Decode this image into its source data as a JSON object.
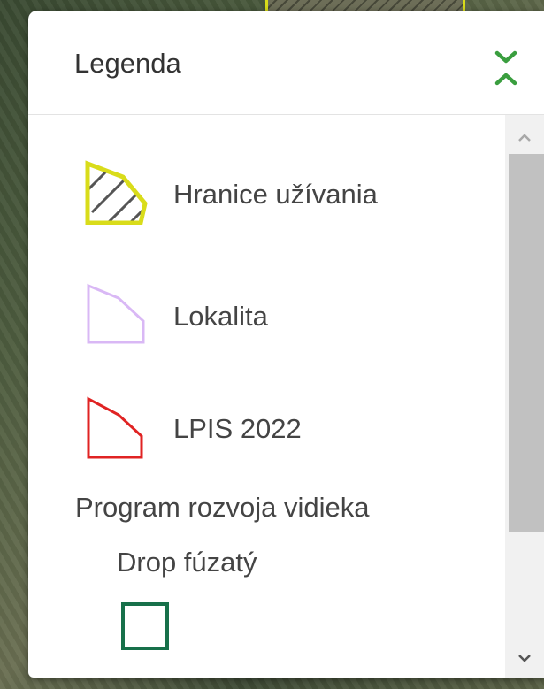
{
  "legend": {
    "title": "Legenda",
    "toggle_icon": "chevron-collapse-icon",
    "accent_color": "#3a9e3f",
    "items": [
      {
        "label": "Hranice užívania",
        "icon": "hatched-polygon-icon",
        "stroke_color": "#d9dc1a"
      },
      {
        "label": "Lokalita",
        "icon": "polygon-outline-icon",
        "stroke_color": "#d9b8f5"
      },
      {
        "label": "LPIS 2022",
        "icon": "polygon-outline-icon",
        "stroke_color": "#e02323"
      }
    ],
    "group": {
      "title": "Program rozvoja vidieka",
      "subgroup": {
        "title": "Drop fúzatý",
        "icon": "square-outline-icon",
        "stroke_color": "#17704a"
      }
    }
  },
  "scrollbar": {
    "up_icon": "chevron-up-icon",
    "down_icon": "chevron-down-icon"
  }
}
